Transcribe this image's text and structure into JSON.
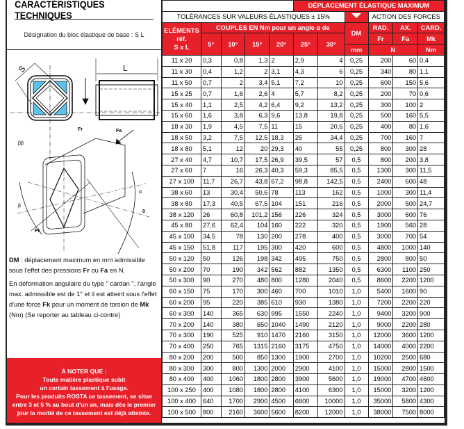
{
  "title": "CARACTÉRISTIQUES TECHNIQUES",
  "designation": "Désignation du bloc élastique de base : S   L",
  "drawing_labels": {
    "S": "S",
    "L": "L",
    "Fr": "Fr",
    "Fa": "Fa",
    "Fk": "Fk",
    "alpha": "α",
    "beta": "β",
    "beta2": "ββ",
    "theta": "0"
  },
  "notes": {
    "p1_bold1": "DM",
    "p1_a": " : déplacement maximum en mm admissible sous l'effet des pressions ",
    "p1_bold2": "Fr",
    "p1_b": " ou ",
    "p1_bold3": "Fa",
    "p1_c": " en N.",
    "p2_a": "En déformation angulaire du type \" cardan \", l'angle max. admissible est de 1° et il est atteint sous l'effet d'une force ",
    "p2_bold1": "Fk",
    "p2_b": " pour un moment de torsion de ",
    "p2_bold2": "Mk",
    "p2_c": " (Nm) (Se reporter au tableau ci-contre)"
  },
  "warning": {
    "title": "À NOTER QUE :",
    "lines": [
      "Toute matière plastique subit",
      "un certain tassement à l'usage.",
      "Pour les produits ROSTA ce tassement, se situe",
      "entre 3 et 5 % au bout d'un an, mais dès le premier",
      "jour la moitié de ce tassement est déjà atteinte."
    ]
  },
  "header": {
    "deplacement": "DÉPLACEMENT ÉLASTIQUE MAXIMUM",
    "tolerances": "TOLÉRANCES SUR VALEURS ÉLASTIQUES ± 15%",
    "action": "ACTION DES FORCES",
    "elements": "ELÉMENTS",
    "ref": "réf.",
    "sxl": "S x L",
    "couples": "COUPLES EN Nm pour un angle α de",
    "angles": [
      "5°",
      "10°",
      "15°",
      "20°",
      "25°",
      "30°"
    ],
    "dm": "DM",
    "mm": "mm",
    "rad": "RAD.",
    "fr": "Fr",
    "ax": "AX.",
    "fa": "Fa",
    "card": "CARD.",
    "mk": "Mk",
    "n": "N",
    "nm": "Nm"
  },
  "colors": {
    "accent": "#e8202a",
    "blue": "#5bc3ea"
  },
  "rows": [
    [
      "11 x 20",
      "0,3",
      "0,8",
      "1,3",
      "2",
      "2,9",
      "4",
      "0,25",
      "200",
      "60",
      "0,4"
    ],
    [
      "11 x 30",
      "0,4",
      "1,2",
      "2",
      "3,1",
      "4,3",
      "6",
      "0,25",
      "340",
      "80",
      "1,1"
    ],
    [
      "11 x 50",
      "0,7",
      "2",
      "3,4",
      "5,1",
      "7,2",
      "10",
      "0,25",
      "600",
      "150",
      "5,6"
    ],
    [
      "15 x 25",
      "0,7",
      "1,6",
      "2,6",
      "4",
      "5,7",
      "8,2",
      "0,25",
      "200",
      "70",
      "0,6"
    ],
    [
      "15 x 40",
      "1,1",
      "2,5",
      "4,2",
      "6,4",
      "9,2",
      "13,2",
      "0,25",
      "300",
      "100",
      "2"
    ],
    [
      "15 x 60",
      "1,6",
      "3,8",
      "6,3",
      "9,6",
      "13,8",
      "19,8",
      "0,25",
      "500",
      "160",
      "5,5"
    ],
    [
      "18 x 30",
      "1,9",
      "4,5",
      "7,5",
      "11",
      "15",
      "20,6",
      "0,25",
      "400",
      "80",
      "1,6"
    ],
    [
      "18 x 50",
      "3,2",
      "7,5",
      "12,5",
      "18,3",
      "25",
      "34,4",
      "0,25",
      "700",
      "160",
      "7"
    ],
    [
      "18 x 80",
      "5,1",
      "12",
      "20",
      "29,3",
      "40",
      "55",
      "0,25",
      "800",
      "300",
      "28"
    ],
    [
      "27 x 40",
      "4,7",
      "10,7",
      "17,5",
      "26,9",
      "39,5",
      "57",
      "0,5",
      "800",
      "200",
      "3,8"
    ],
    [
      "27 x 60",
      "7",
      "16",
      "26,3",
      "40,3",
      "59,3",
      "85,5",
      "0,5",
      "1300",
      "300",
      "11,5"
    ],
    [
      "27 x 100",
      "11,7",
      "26,7",
      "43,8",
      "67,2",
      "98,8",
      "142,5",
      "0,5",
      "2400",
      "600",
      "48"
    ],
    [
      "38 x 60",
      "13",
      "30,4",
      "50,6",
      "78",
      "113",
      "162",
      "0,5",
      "1000",
      "300",
      "11,4"
    ],
    [
      "38 x 80",
      "17,3",
      "40,5",
      "67,5",
      "104",
      "151",
      "216",
      "0,5",
      "2000",
      "500",
      "24,7"
    ],
    [
      "38 x 120",
      "26",
      "60,8",
      "101,2",
      "156",
      "226",
      "324",
      "0,5",
      "3000",
      "600",
      "76"
    ],
    [
      "45 x 80",
      "27,6",
      "62,4",
      "104",
      "160",
      "222",
      "320",
      "0,5",
      "1900",
      "560",
      "28"
    ],
    [
      "45 x 100",
      "34,5",
      "78",
      "130",
      "200",
      "278",
      "400",
      "0,5",
      "3000",
      "700",
      "54"
    ],
    [
      "45 x 150",
      "51,8",
      "117",
      "195",
      "300",
      "420",
      "600",
      "0,5",
      "4800",
      "1000",
      "140"
    ],
    [
      "50 x 120",
      "50",
      "126",
      "198",
      "342",
      "495",
      "750",
      "0,5",
      "2800",
      "800",
      "50"
    ],
    [
      "50 x 200",
      "70",
      "190",
      "342",
      "562",
      "882",
      "1350",
      "0,5",
      "6300",
      "1100",
      "250"
    ],
    [
      "50 x 300",
      "90",
      "270",
      "480",
      "800",
      "1280",
      "2040",
      "0,5",
      "8600",
      "2200",
      "1200"
    ],
    [
      "60 x 150",
      "75",
      "170",
      "300",
      "460",
      "700",
      "1010",
      "1,0",
      "5400",
      "1600",
      "90"
    ],
    [
      "60 x 200",
      "95",
      "220",
      "385",
      "610",
      "930",
      "1380",
      "1,0",
      "7200",
      "2200",
      "220"
    ],
    [
      "60 x 300",
      "140",
      "365",
      "630",
      "995",
      "1550",
      "2240",
      "1,0",
      "9400",
      "3200",
      "900"
    ],
    [
      "70 x 200",
      "140",
      "380",
      "650",
      "1040",
      "1490",
      "2120",
      "1,0",
      "9000",
      "2200",
      "280"
    ],
    [
      "70 x 300",
      "190",
      "525",
      "910",
      "1470",
      "2160",
      "3150",
      "1,0",
      "12000",
      "3600",
      "1200"
    ],
    [
      "70 x 400",
      "250",
      "765",
      "1315",
      "2160",
      "3175",
      "4750",
      "1,0",
      "14000",
      "4000",
      "2200"
    ],
    [
      "80 x 200",
      "200",
      "500",
      "850",
      "1300",
      "1900",
      "2700",
      "1,0",
      "10200",
      "2500",
      "680"
    ],
    [
      "80 x 300",
      "300",
      "800",
      "1300",
      "2000",
      "2900",
      "4100",
      "1,0",
      "15000",
      "2800",
      "1500"
    ],
    [
      "80 x 400",
      "400",
      "1060",
      "1800",
      "2800",
      "3900",
      "5600",
      "1,0",
      "19000",
      "4700",
      "4600"
    ],
    [
      "100 x 250",
      "400",
      "1080",
      "1800",
      "2800",
      "4100",
      "6300",
      "1,0",
      "15000",
      "3200",
      "1200"
    ],
    [
      "100 x 400",
      "640",
      "1700",
      "2900",
      "4500",
      "6600",
      "10000",
      "1,0",
      "35000",
      "5800",
      "4300"
    ],
    [
      "100 x 500",
      "800",
      "2160",
      "3600",
      "5600",
      "8200",
      "12000",
      "1,0",
      "38000",
      "7500",
      "8000"
    ]
  ]
}
